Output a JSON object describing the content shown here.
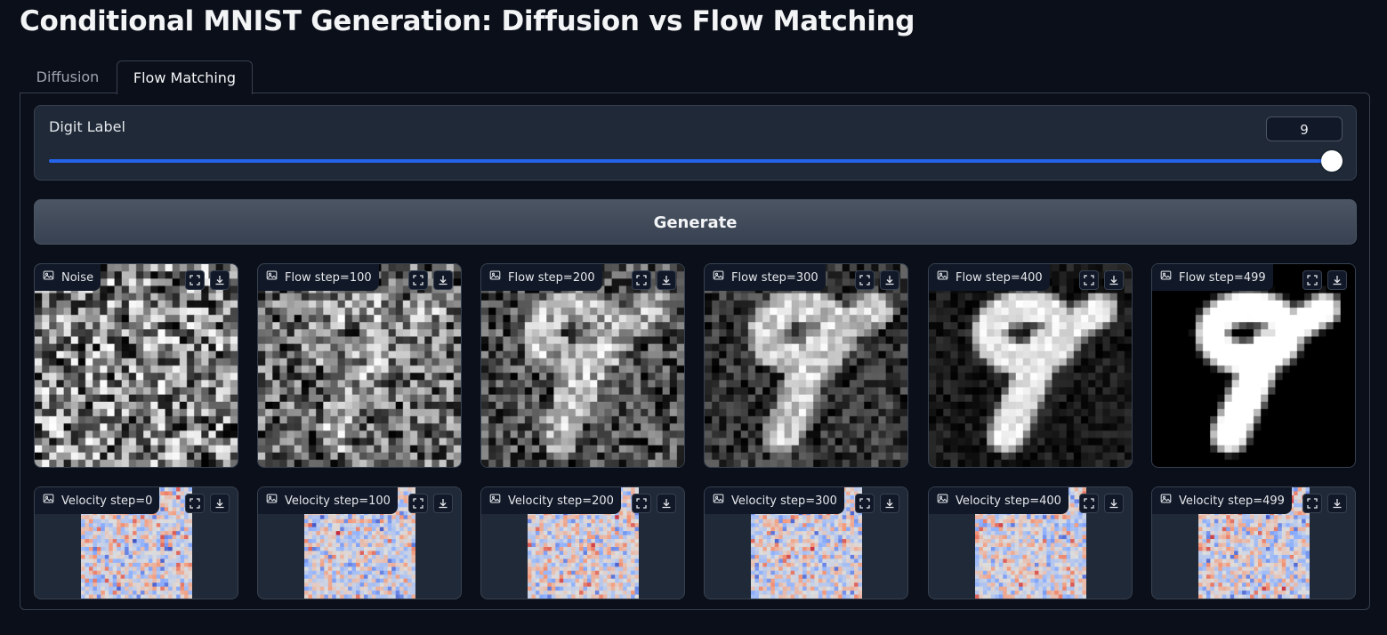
{
  "app": {
    "title": "Conditional MNIST Generation: Diffusion vs Flow Matching"
  },
  "tabs": [
    {
      "label": "Diffusion",
      "selected": false
    },
    {
      "label": "Flow Matching",
      "selected": true
    }
  ],
  "slider": {
    "label": "Digit Label",
    "value": "9",
    "min": 0,
    "max": 9
  },
  "generate_button": {
    "label": "Generate"
  },
  "flow_images": [
    {
      "label": "Noise",
      "step": 0
    },
    {
      "label": "Flow step=100",
      "step": 100
    },
    {
      "label": "Flow step=200",
      "step": 200
    },
    {
      "label": "Flow step=300",
      "step": 300
    },
    {
      "label": "Flow step=400",
      "step": 400
    },
    {
      "label": "Flow step=499",
      "step": 499
    }
  ],
  "velocity_images": [
    {
      "label": "Velocity step=0"
    },
    {
      "label": "Velocity step=100"
    },
    {
      "label": "Velocity step=200"
    },
    {
      "label": "Velocity step=300"
    },
    {
      "label": "Velocity step=400"
    },
    {
      "label": "Velocity step=499"
    }
  ],
  "icons": {
    "label_icon": "image-icon",
    "fullscreen": "fullscreen-icon",
    "download": "download-icon"
  },
  "colors": {
    "accent": "#2563eb",
    "background": "#0b0f19",
    "block": "#1f2937",
    "border": "#374151"
  }
}
